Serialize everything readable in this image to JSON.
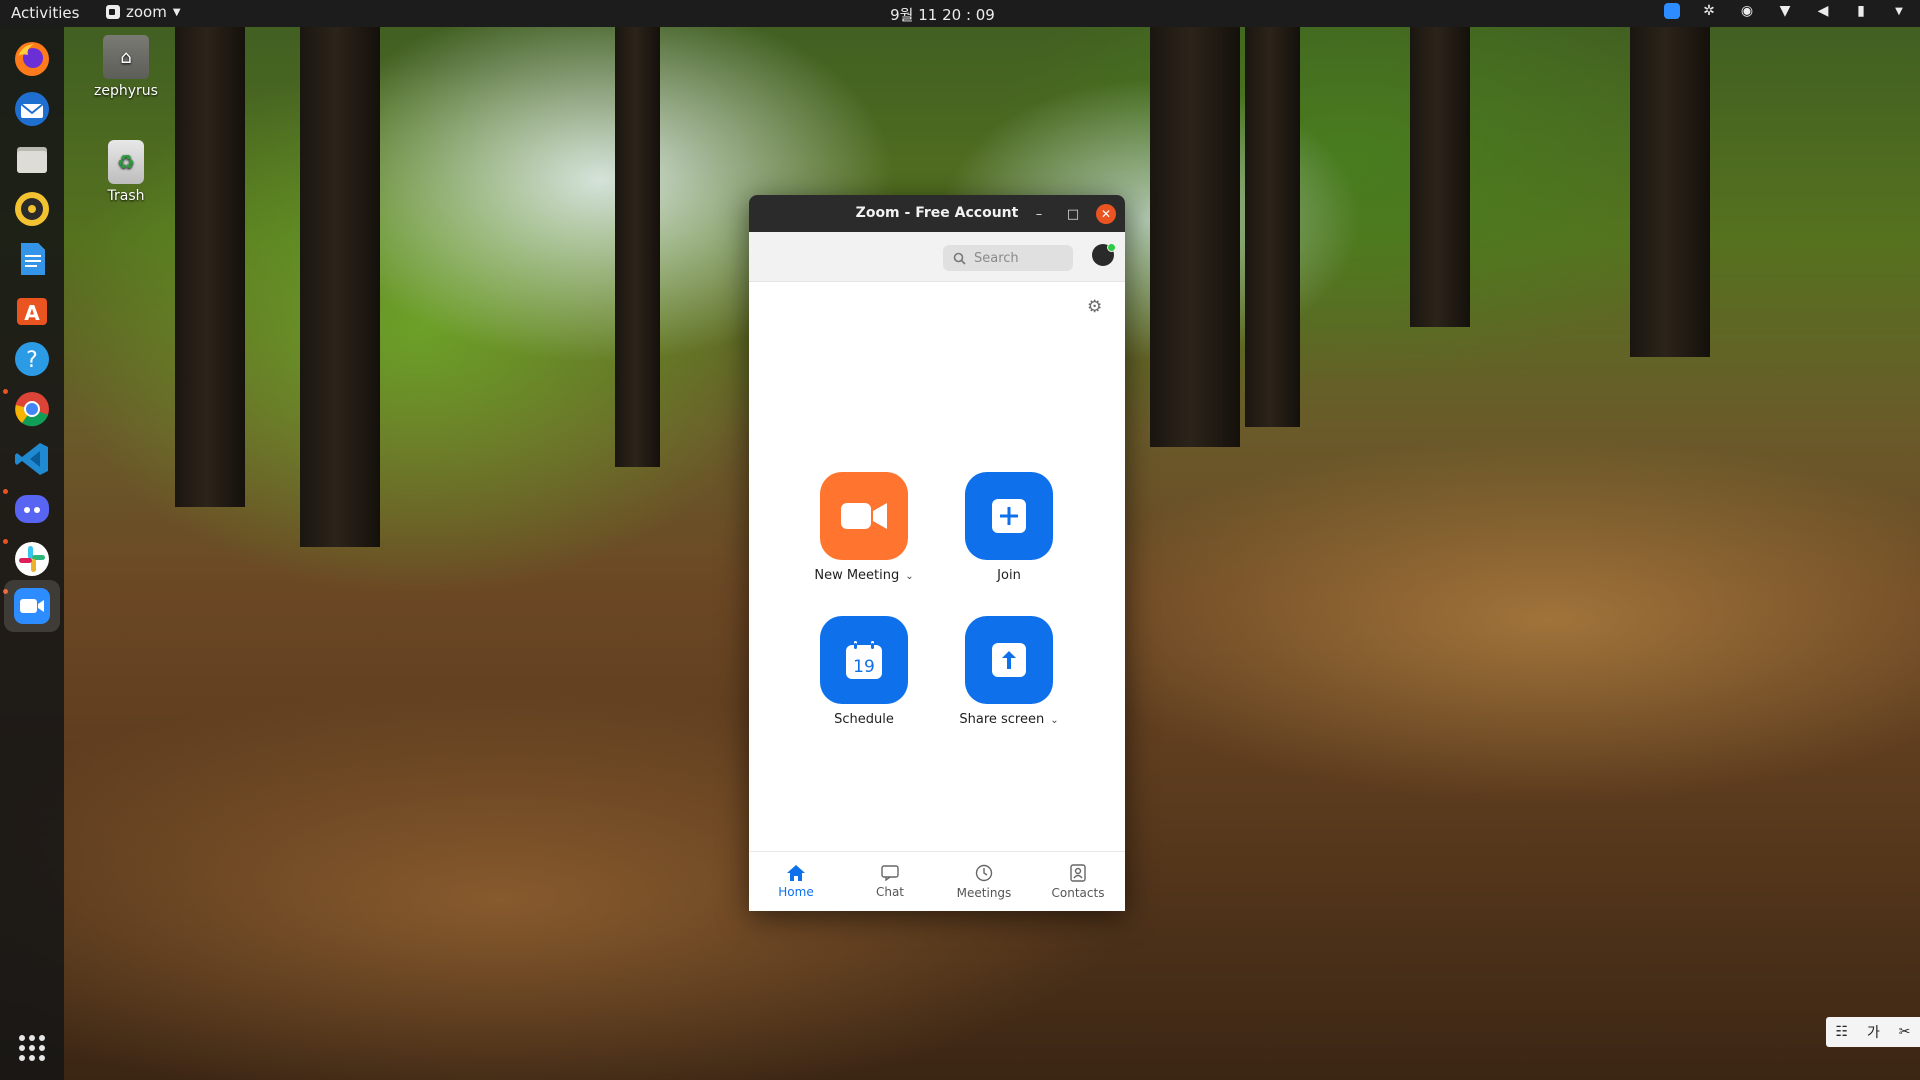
{
  "topbar": {
    "activities": "Activities",
    "app_menu": "zoom",
    "clock": "9월 11  20 : 09"
  },
  "dock": {
    "items": [
      "firefox",
      "thunderbird",
      "files",
      "rhythmbox",
      "libreoffice-writer",
      "ubuntu-software",
      "help",
      "chrome",
      "vscode",
      "discord",
      "slack",
      "zoom"
    ],
    "show_apps": "show-applications"
  },
  "desktop": {
    "home_label": "zephyrus",
    "trash_label": "Trash"
  },
  "zoom": {
    "title": "Zoom - Free Account",
    "search_placeholder": "Search",
    "actions": {
      "new_meeting": "New Meeting",
      "join": "Join",
      "schedule": "Schedule",
      "schedule_day": "19",
      "share_screen": "Share screen"
    },
    "nav": {
      "home": "Home",
      "chat": "Chat",
      "meetings": "Meetings",
      "contacts": "Contacts"
    },
    "colors": {
      "orange": "#ff742e",
      "blue": "#0e71eb"
    }
  },
  "ime": {
    "hangul": "가"
  }
}
